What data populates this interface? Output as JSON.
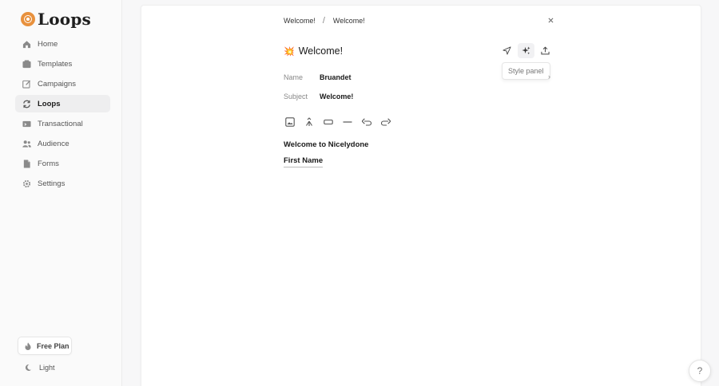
{
  "brand": {
    "name": "Loops",
    "accent": "#e8913d"
  },
  "sidebar": {
    "items": [
      {
        "label": "Home",
        "icon": "home-icon",
        "active": false
      },
      {
        "label": "Templates",
        "icon": "templates-icon",
        "active": false
      },
      {
        "label": "Campaigns",
        "icon": "campaigns-icon",
        "active": false
      },
      {
        "label": "Loops",
        "icon": "loops-icon",
        "active": true
      },
      {
        "label": "Transactional",
        "icon": "transactional-icon",
        "active": false
      },
      {
        "label": "Audience",
        "icon": "audience-icon",
        "active": false
      },
      {
        "label": "Forms",
        "icon": "forms-icon",
        "active": false
      },
      {
        "label": "Settings",
        "icon": "settings-icon",
        "active": false
      }
    ],
    "plan_label": "Free Plan",
    "theme_label": "Light"
  },
  "breadcrumb": {
    "first": "Welcome!",
    "separator": "/",
    "second": "Welcome!"
  },
  "email": {
    "title_emoji": "💥",
    "title": "Welcome!",
    "fields": [
      {
        "label": "Name",
        "value": "Bruandet"
      },
      {
        "label": "Subject",
        "value": "Welcome!"
      }
    ],
    "body": [
      "Welcome to Nicelydone",
      "First Name"
    ]
  },
  "toolbar": {
    "tooltip": "Style panel",
    "buttons": [
      "send-icon",
      "style-panel-icon",
      "upload-icon"
    ]
  },
  "editor_tools": [
    "image-icon",
    "merge-tag-icon",
    "button-icon",
    "divider-icon",
    "undo-icon",
    "redo-icon"
  ],
  "help": {
    "label": "?"
  }
}
